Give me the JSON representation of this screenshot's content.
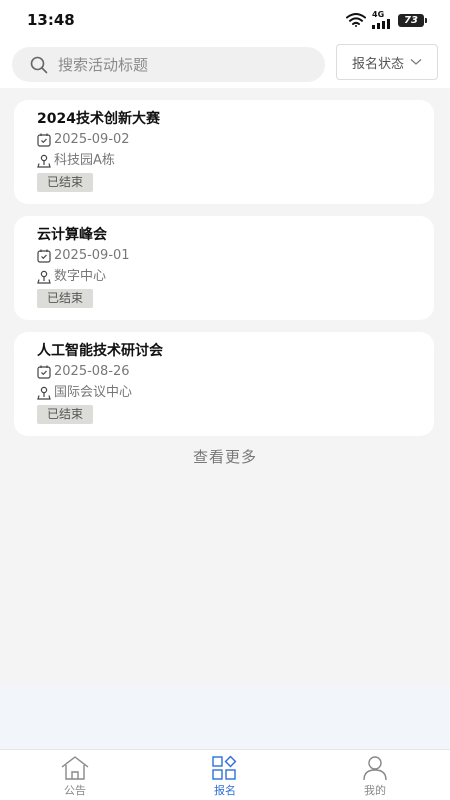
{
  "status_bar": {
    "time": "13:48",
    "network": "4G",
    "battery": "73",
    "icons": [
      "wifi-icon",
      "signal-icon",
      "battery-icon"
    ]
  },
  "search": {
    "placeholder": "搜索活动标题",
    "filter_label": "报名状态"
  },
  "events": [
    {
      "title": "2024技术创新大赛",
      "date": "2025-09-02",
      "location": "科技园A栋",
      "status": "已结束"
    },
    {
      "title": "云计算峰会",
      "date": "2025-09-01",
      "location": "数字中心",
      "status": "已结束"
    },
    {
      "title": "人工智能技术研讨会",
      "date": "2025-08-26",
      "location": "国际会议中心",
      "status": "已结束"
    }
  ],
  "load_more": "查看更多",
  "tabs": [
    {
      "label": "公告",
      "icon": "home-icon",
      "active": false
    },
    {
      "label": "报名",
      "icon": "grid-icon",
      "active": true
    },
    {
      "label": "我的",
      "icon": "user-icon",
      "active": false
    }
  ],
  "colors": {
    "accent": "#2e6fd9",
    "tag_bg": "#dcdcd8",
    "page_bg": "#f4f4f4"
  }
}
